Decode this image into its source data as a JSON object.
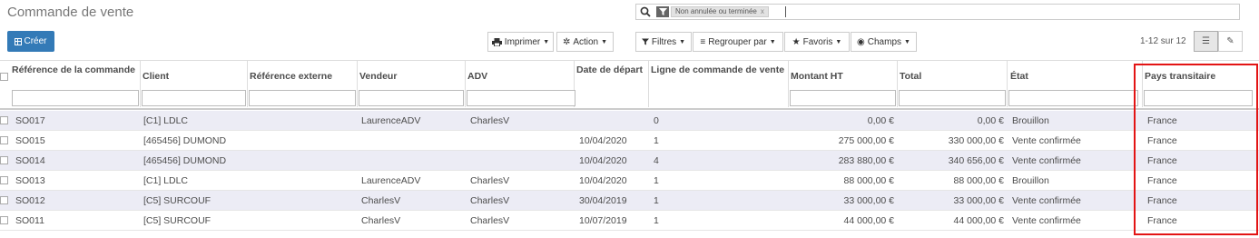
{
  "page_title": "Commande de vente",
  "search": {
    "facet_value": "Non annulée ou terminée",
    "facet_remove": "x"
  },
  "create_button": "Créer",
  "toolbar": {
    "print": "Imprimer",
    "action": "Action",
    "filters": "Filtres",
    "group_by": "Regrouper par",
    "favorites": "Favoris",
    "fields": "Champs"
  },
  "pager": "1-12 sur 12",
  "columns": {
    "reference": "Référence de la commande",
    "client": "Client",
    "external_ref": "Référence externe",
    "seller": "Vendeur",
    "adv": "ADV",
    "departure_date": "Date de départ",
    "order_line": "Ligne de commande de vente",
    "amount_ht": "Montant HT",
    "total": "Total",
    "state": "État",
    "transit_country": "Pays transitaire"
  },
  "rows": [
    {
      "ref": "SO017",
      "client": "[C1] LDLC",
      "extref": "",
      "seller": "LaurenceADV",
      "adv": "CharlesV",
      "date": "",
      "line": "0",
      "ht": "0,00 €",
      "total": "0,00 €",
      "state": "Brouillon",
      "country": "France"
    },
    {
      "ref": "SO015",
      "client": "[465456] DUMOND",
      "extref": "",
      "seller": "",
      "adv": "",
      "date": "10/04/2020",
      "line": "1",
      "ht": "275 000,00 €",
      "total": "330 000,00 €",
      "state": "Vente confirmée",
      "country": "France"
    },
    {
      "ref": "SO014",
      "client": "[465456] DUMOND",
      "extref": "",
      "seller": "",
      "adv": "",
      "date": "10/04/2020",
      "line": "4",
      "ht": "283 880,00 €",
      "total": "340 656,00 €",
      "state": "Vente confirmée",
      "country": "France"
    },
    {
      "ref": "SO013",
      "client": "[C1] LDLC",
      "extref": "",
      "seller": "LaurenceADV",
      "adv": "CharlesV",
      "date": "10/04/2020",
      "line": "1",
      "ht": "88 000,00 €",
      "total": "88 000,00 €",
      "state": "Brouillon",
      "country": "France"
    },
    {
      "ref": "SO012",
      "client": "[C5] SURCOUF",
      "extref": "",
      "seller": "CharlesV",
      "adv": "CharlesV",
      "date": "30/04/2019",
      "line": "1",
      "ht": "33 000,00 €",
      "total": "33 000,00 €",
      "state": "Vente confirmée",
      "country": "France"
    },
    {
      "ref": "SO011",
      "client": "[C5] SURCOUF",
      "extref": "",
      "seller": "CharlesV",
      "adv": "CharlesV",
      "date": "10/07/2019",
      "line": "1",
      "ht": "44 000,00 €",
      "total": "44 000,00 €",
      "state": "Vente confirmée",
      "country": "France"
    }
  ],
  "colors": {
    "primary": "#337ab7",
    "highlight": "#e31414",
    "row_alt": "#ececf5"
  }
}
